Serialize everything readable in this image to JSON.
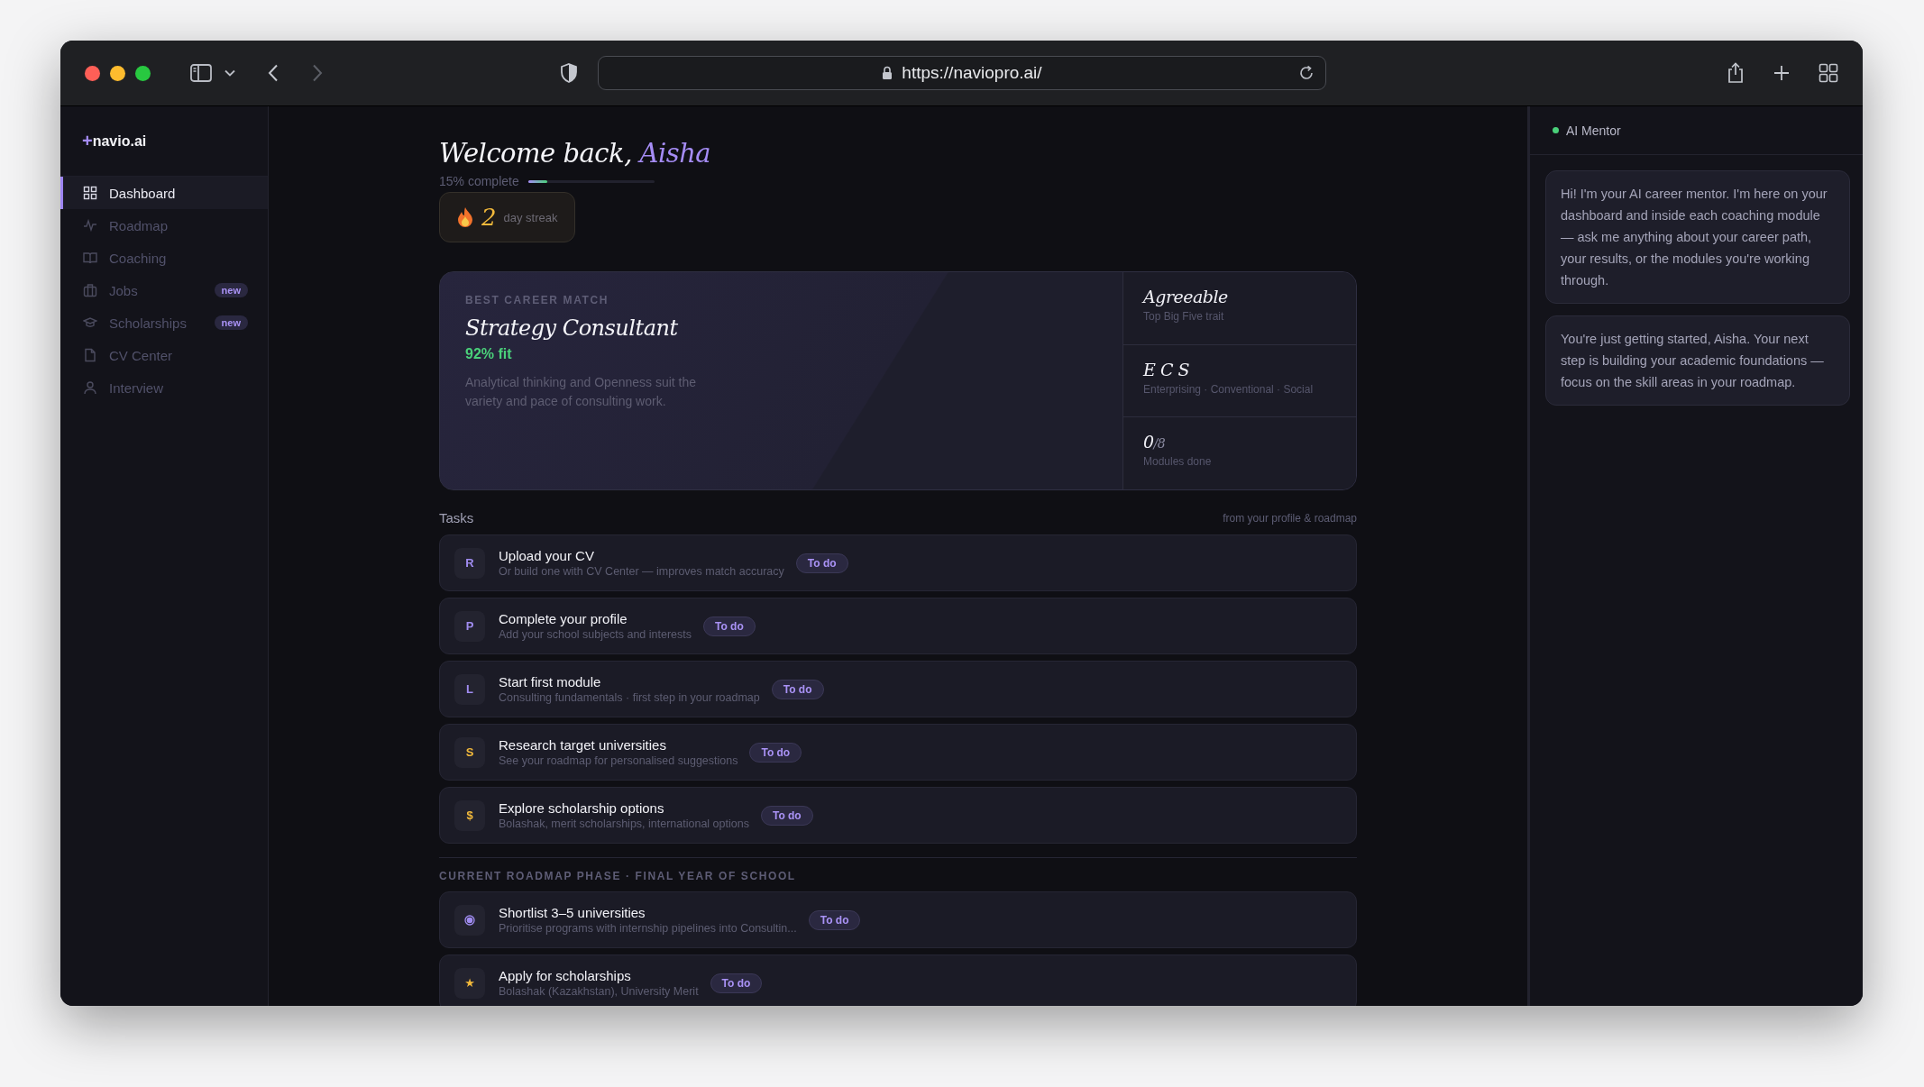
{
  "browser": {
    "url": "https://naviopro.ai/"
  },
  "sidebar": {
    "logo_mark": "+",
    "logo": "navio.ai",
    "items": [
      {
        "label": "Dashboard",
        "kind": "grid",
        "selected": true
      },
      {
        "label": "Roadmap",
        "kind": "pulse",
        "selected": false
      },
      {
        "label": "Coaching",
        "kind": "book",
        "selected": false
      },
      {
        "label": "Jobs",
        "kind": "briefcase",
        "selected": false,
        "badge": "new"
      },
      {
        "label": "Scholarships",
        "kind": "cap",
        "selected": false,
        "badge": "new"
      },
      {
        "label": "CV Center",
        "kind": "file",
        "selected": false
      },
      {
        "label": "Interview",
        "kind": "person",
        "selected": false
      }
    ]
  },
  "header": {
    "greeting": "Welcome back,",
    "name": "Aisha",
    "progress_label": "15% complete",
    "level": 0.15,
    "streak_count": "2",
    "streak_label": "day streak"
  },
  "career_match": {
    "label": "BEST CAREER MATCH",
    "title": "Strategy Consultant",
    "fit": "92% fit",
    "description": "Analytical thinking and Openness suit the variety and pace of consulting work."
  },
  "stats": [
    {
      "value": "Agreeable",
      "label": "Top Big Five trait"
    },
    {
      "value": "E C S",
      "label": "Enterprising · Conventional · Social"
    },
    {
      "value": "0",
      "suffix": "/8",
      "label": "Modules done"
    }
  ],
  "tasks": {
    "title": "Tasks",
    "note": "from your profile & roadmap",
    "items": [
      {
        "kind": "letter",
        "icon": "R",
        "color": "#a08cf0",
        "title": "Upload your CV",
        "subtitle": "Or build one with CV Center — improves match accuracy",
        "status": "To do"
      },
      {
        "kind": "letter",
        "icon": "P",
        "color": "#a08cf0",
        "title": "Complete your profile",
        "subtitle": "Add your school subjects and interests",
        "status": "To do"
      },
      {
        "kind": "letter",
        "icon": "L",
        "color": "#a08cf0",
        "title": "Start first module",
        "subtitle": "Consulting fundamentals · first step in your roadmap",
        "status": "To do"
      },
      {
        "kind": "letter",
        "icon": "S",
        "color": "#f2b93b",
        "title": "Research target universities",
        "subtitle": "See your roadmap for personalised suggestions",
        "status": "To do"
      },
      {
        "kind": "letter",
        "icon": "$",
        "color": "#f2b93b",
        "title": "Explore scholarship options",
        "subtitle": "Bolashak, merit scholarships, international options",
        "status": "To do"
      }
    ]
  },
  "phase": {
    "label": "CURRENT ROADMAP PHASE · FINAL YEAR OF SCHOOL",
    "items": [
      {
        "kind": "dot",
        "color": "#a08cf0",
        "title": "Shortlist 3–5 universities",
        "subtitle": "Prioritise programs with internship pipelines into Consultin...",
        "status": "To do"
      },
      {
        "kind": "letter",
        "icon": "★",
        "color": "#f2b93b",
        "title": "Apply for scholarships",
        "subtitle": "Bolashak (Kazakhstan), University Merit",
        "status": "To do"
      }
    ]
  },
  "mentor": {
    "title": "AI Mentor",
    "online": true,
    "messages": [
      "Hi! I'm your AI career mentor. I'm here on your dashboard and inside each coaching module — ask me anything about your career path, your results, or the modules you're working through.",
      "You're just getting started, Aisha. Your next step is building your academic foundations — focus on the skill areas in your roadmap."
    ]
  }
}
